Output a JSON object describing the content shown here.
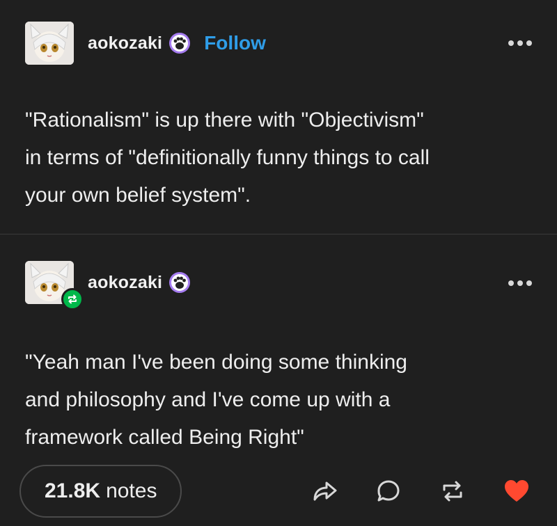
{
  "posts": [
    {
      "username": "aokozaki",
      "badge_icon": "paw-badge-icon",
      "follow_label": "Follow",
      "text": "\"Rationalism\" is up there with \"Objectivism\"\nin terms of \"definitionally funny things to call\nyour own belief system\"."
    },
    {
      "username": "aokozaki",
      "badge_icon": "paw-badge-icon",
      "reblog_icon": "reblog-icon",
      "text": "\"Yeah man I've been doing some thinking\nand philosophy and I've come up with a\nframework called Being Right\""
    }
  ],
  "footer": {
    "notes_count": "21.8K",
    "notes_label": "notes",
    "actions": [
      "share-icon",
      "reply-icon",
      "reblog-icon",
      "like-icon"
    ]
  },
  "colors": {
    "background": "#1f1f1f",
    "follow": "#2f9de8",
    "like": "#ff4930",
    "reblog_badge": "#00b84a",
    "badge_purple": "#a57cf0"
  }
}
